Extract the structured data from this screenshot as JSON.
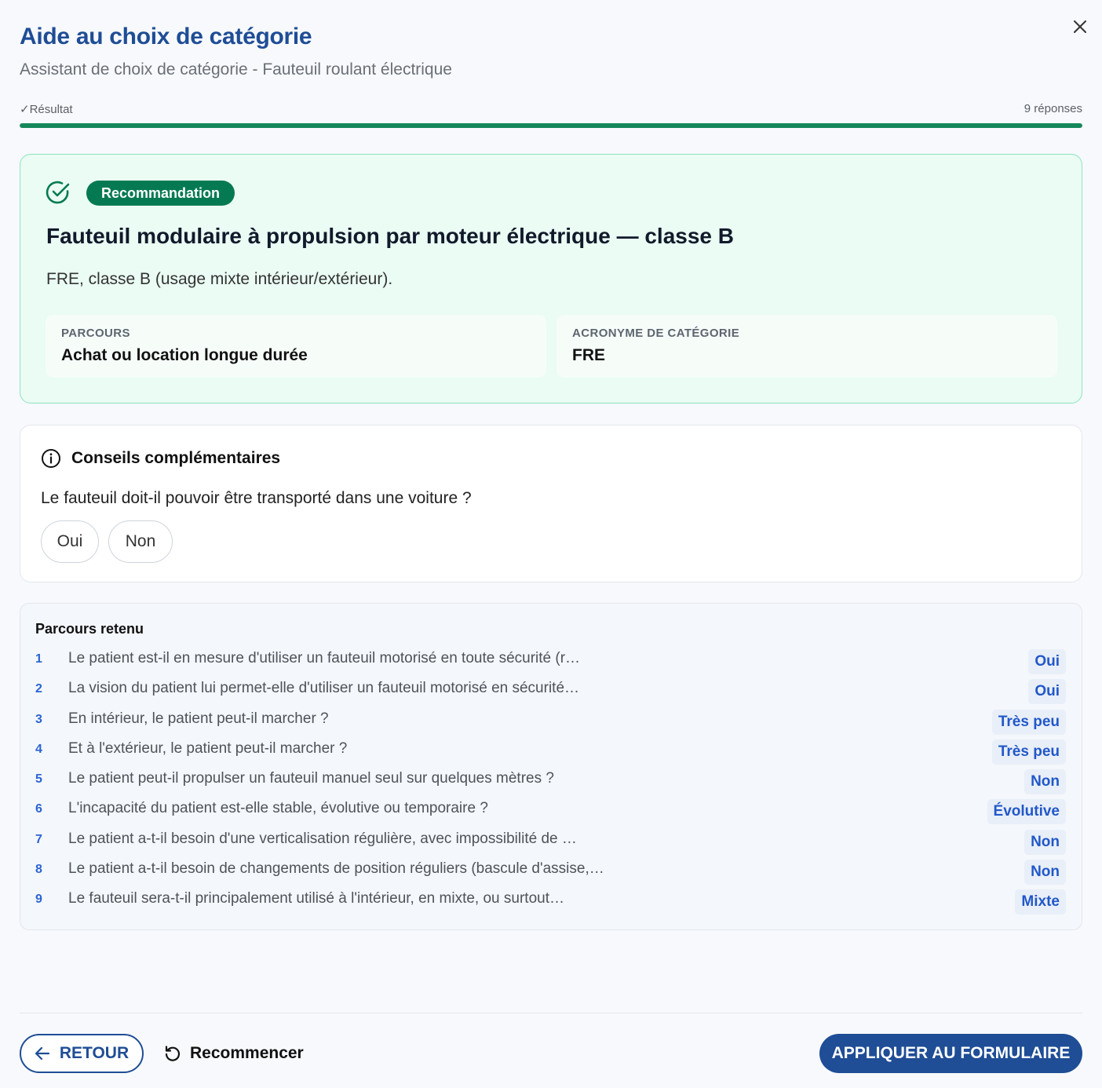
{
  "header": {
    "title": "Aide au choix de catégorie",
    "subtitle": "Assistant de choix de catégorie - Fauteuil roulant électrique"
  },
  "progress": {
    "label": "✓Résultat",
    "count": "9 réponses",
    "fraction": 1.0,
    "color": "#15875a"
  },
  "recommendation": {
    "badge": "Recommandation",
    "title": "Fauteuil modulaire à propulsion par moteur électrique — classe B",
    "description": "FRE, classe B (usage mixte intérieur/extérieur).",
    "route_label": "PARCOURS",
    "route_value": "Achat ou location longue durée",
    "acronym_label": "ACRONYME DE CATÉGORIE",
    "acronym_value": "FRE"
  },
  "advice": {
    "title": "Conseils complémentaires",
    "question": "Le fauteuil doit-il pouvoir être transporté dans une voiture ?",
    "options": [
      "Oui",
      "Non"
    ]
  },
  "path": {
    "title": "Parcours retenu",
    "items": [
      {
        "num": "1",
        "question": "Le patient est-il en mesure d'utiliser un fauteuil motorisé en toute sécurité (r…",
        "answer": "Oui"
      },
      {
        "num": "2",
        "question": "La vision du patient lui permet-elle d'utiliser un fauteuil motorisé en sécurité…",
        "answer": "Oui"
      },
      {
        "num": "3",
        "question": "En intérieur, le patient peut-il marcher ?",
        "answer": "Très peu"
      },
      {
        "num": "4",
        "question": "Et à l'extérieur, le patient peut-il marcher ?",
        "answer": "Très peu"
      },
      {
        "num": "5",
        "question": "Le patient peut-il propulser un fauteuil manuel seul sur quelques mètres ?",
        "answer": "Non"
      },
      {
        "num": "6",
        "question": "L'incapacité du patient est-elle stable, évolutive ou temporaire ?",
        "answer": "Évolutive"
      },
      {
        "num": "7",
        "question": "Le patient a-t-il besoin d'une verticalisation régulière, avec impossibilité de …",
        "answer": "Non"
      },
      {
        "num": "8",
        "question": "Le patient a-t-il besoin de changements de position réguliers (bascule d'assise,…",
        "answer": "Non"
      },
      {
        "num": "9",
        "question": "Le fauteuil sera-t-il principalement utilisé à l'intérieur, en mixte, ou surtout…",
        "answer": "Mixte"
      }
    ]
  },
  "footer": {
    "back_label": "RETOUR",
    "restart_label": "Recommencer",
    "apply_label": "APPLIQUER AU FORMULAIRE"
  },
  "icons": {
    "close": "close-icon",
    "check": "check-circle-icon",
    "info": "info-icon",
    "back": "arrow-left-icon",
    "restart": "restart-icon"
  },
  "colors": {
    "brand": "#1f4d96",
    "success": "#057a52",
    "answer": "#2158c9"
  }
}
